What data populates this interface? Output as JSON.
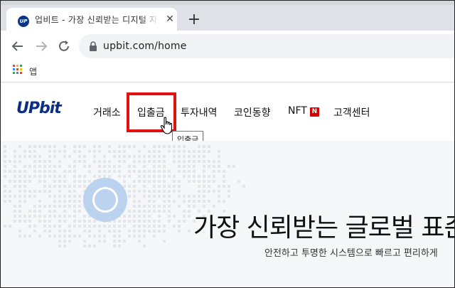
{
  "browser": {
    "tab": {
      "favicon_text": "UP",
      "title": "업비트 - 가장 신뢰받는 디지털 자산 거래소"
    },
    "url": "upbit.com/home",
    "bookmarks": {
      "apps_label": "앱"
    }
  },
  "site": {
    "logo": "UPbit",
    "nav": {
      "exchange": "거래소",
      "deposit_withdraw": "입출금",
      "investments": "투자내역",
      "coin_trends": "코인동향",
      "nft": "NFT",
      "nft_badge": "N",
      "support": "고객센터"
    },
    "tooltip": "입출금",
    "hero": {
      "title": "가장 신뢰받는 글로벌 표준",
      "subtitle": "안전하고 투명한 시스템으로 빠르고 편리하게"
    }
  },
  "colors": {
    "brand": "#0a2e86",
    "highlight": "#e31010",
    "nft_badge": "#d60000"
  }
}
